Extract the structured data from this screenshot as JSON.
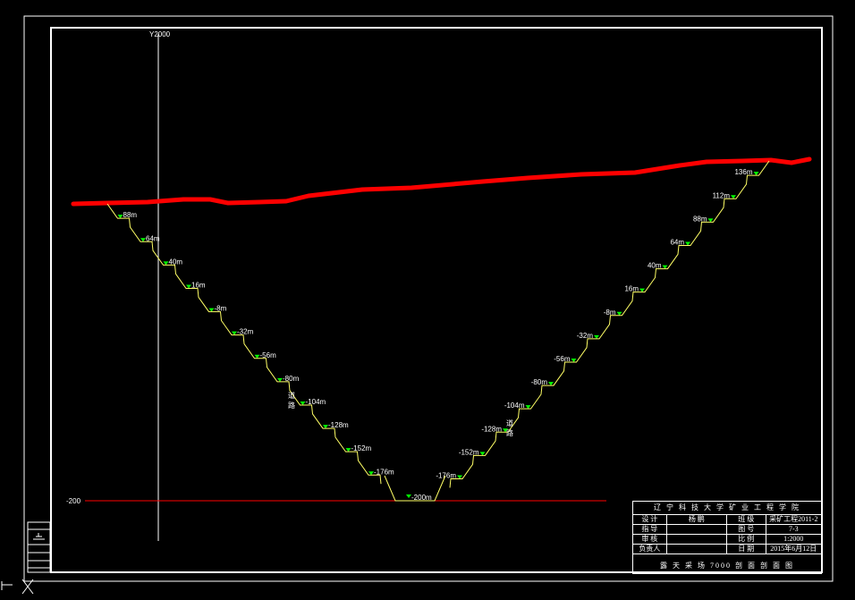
{
  "axis": {
    "y_label": "Y2000",
    "baseline_label": "-200"
  },
  "left_benches": [
    "88m",
    "64m",
    "40m",
    "16m",
    "-8m",
    "-32m",
    "-56m",
    "-80m",
    "-104m",
    "-128m",
    "-152m",
    "-176m"
  ],
  "right_benches": [
    "136m",
    "112m",
    "88m",
    "64m",
    "40m",
    "16m",
    "-8m",
    "-32m",
    "-56m",
    "-80m",
    "-104m",
    "-128m",
    "-152m",
    "-176m"
  ],
  "bottom_bench": "-200m",
  "road_label_chars": [
    "道",
    "路"
  ],
  "title_block": {
    "school": "辽 宁 科 技 大 学 矿 业 工 程 学 院",
    "rows": [
      [
        "设 计",
        "杨 鹏",
        "班 级",
        "采矿工程2011-2"
      ],
      [
        "指 导",
        "",
        "图 号",
        "7-3"
      ],
      [
        "审 核",
        "",
        "比 例",
        "1:2000"
      ],
      [
        "负责人",
        "",
        "日 期",
        "2015年6月12日"
      ]
    ],
    "drawing_title": "露 天 采 场 7000 剖 面 剖 面 图"
  },
  "colors": {
    "background": "#000000",
    "frame": "#ffffff",
    "terrain": "#ff0000",
    "slope": "#ffff66",
    "bench_marker": "#00ff00",
    "baseline": "#ff0000"
  }
}
